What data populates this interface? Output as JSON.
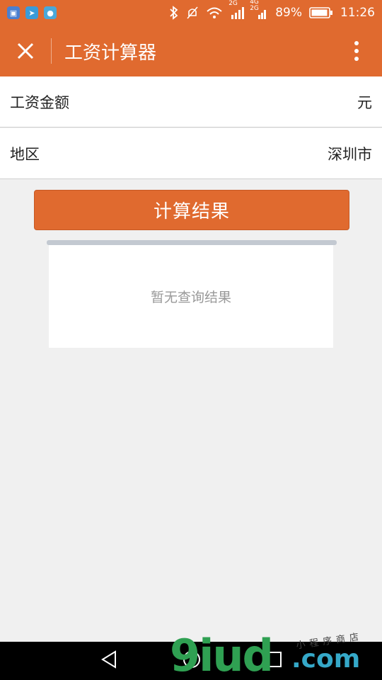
{
  "status_bar": {
    "battery": "89%",
    "time": "11:26",
    "signal_1": "2G",
    "signal_2_top": "4G",
    "signal_2_bottom": "2G"
  },
  "header": {
    "title": "工资计算器"
  },
  "form": {
    "salary_label": "工资金额",
    "salary_unit": "元",
    "region_label": "地区",
    "region_value": "深圳市"
  },
  "calculate_button": "计算结果",
  "result": {
    "empty_text": "暂无查询结果"
  },
  "watermark": {
    "brand": "9iud",
    "domain": ".com",
    "tagline": "小程序商店"
  },
  "colors": {
    "accent": "#e06a2f",
    "background": "#f0f0f0",
    "watermark_green": "#2fa052",
    "watermark_blue": "#35a8c8"
  }
}
